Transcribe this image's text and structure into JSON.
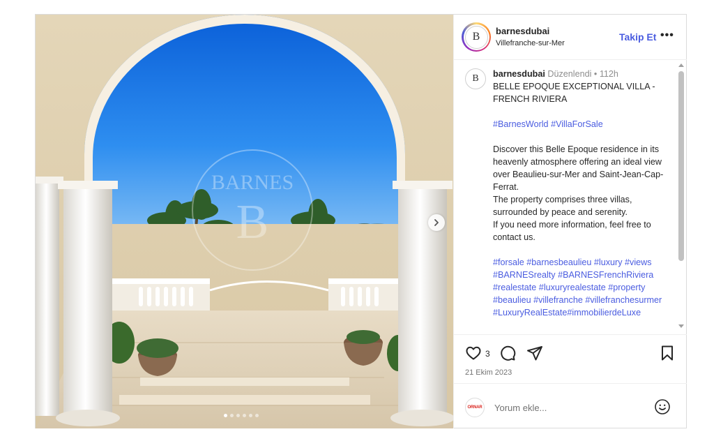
{
  "post": {
    "username": "barnesdubai",
    "location": "Villefranche-sur-Mer",
    "follow_label": "Takip Et",
    "more_label": "•••",
    "avatar_letter": "B"
  },
  "photo": {
    "watermark": "BARNES",
    "watermark_letter": "B",
    "carousel_count": 6,
    "carousel_index": 1
  },
  "caption": {
    "username": "barnesdubai",
    "edited": "Düzenlendi",
    "separator": "•",
    "time": "112h",
    "title": "BELLE EPOQUE EXCEPTIONAL VILLA - FRENCH RIVIERA",
    "tags1": "#BarnesWorld #VillaForSale",
    "body": "Discover this Belle Epoque residence in its heavenly atmosphere offering an ideal view over Beaulieu-sur-Mer and Saint-Jean-Cap-Ferrat.\nThe property comprises three villas, surrounded by peace and serenity.\nIf you need more information, feel free to contact us.",
    "tags2": "#forsale #barnesbeaulieu #luxury #views #BARNESrealty #BARNESFrenchRiviera #realestate #luxuryrealestate #property #beaulieu #villefranche #villefranchesurmer #LuxuryRealEstate#immobilierdeLuxe"
  },
  "actions": {
    "like_count": "3",
    "date": "21 Ekim 2023"
  },
  "comment": {
    "avatar_text": "ORNAR",
    "placeholder": "Yorum ekle..."
  },
  "icons": {
    "like": "heart-icon",
    "comment": "comment-icon",
    "share": "share-icon",
    "save": "bookmark-icon",
    "emoji": "emoji-icon",
    "next": "chevron-right-icon"
  }
}
